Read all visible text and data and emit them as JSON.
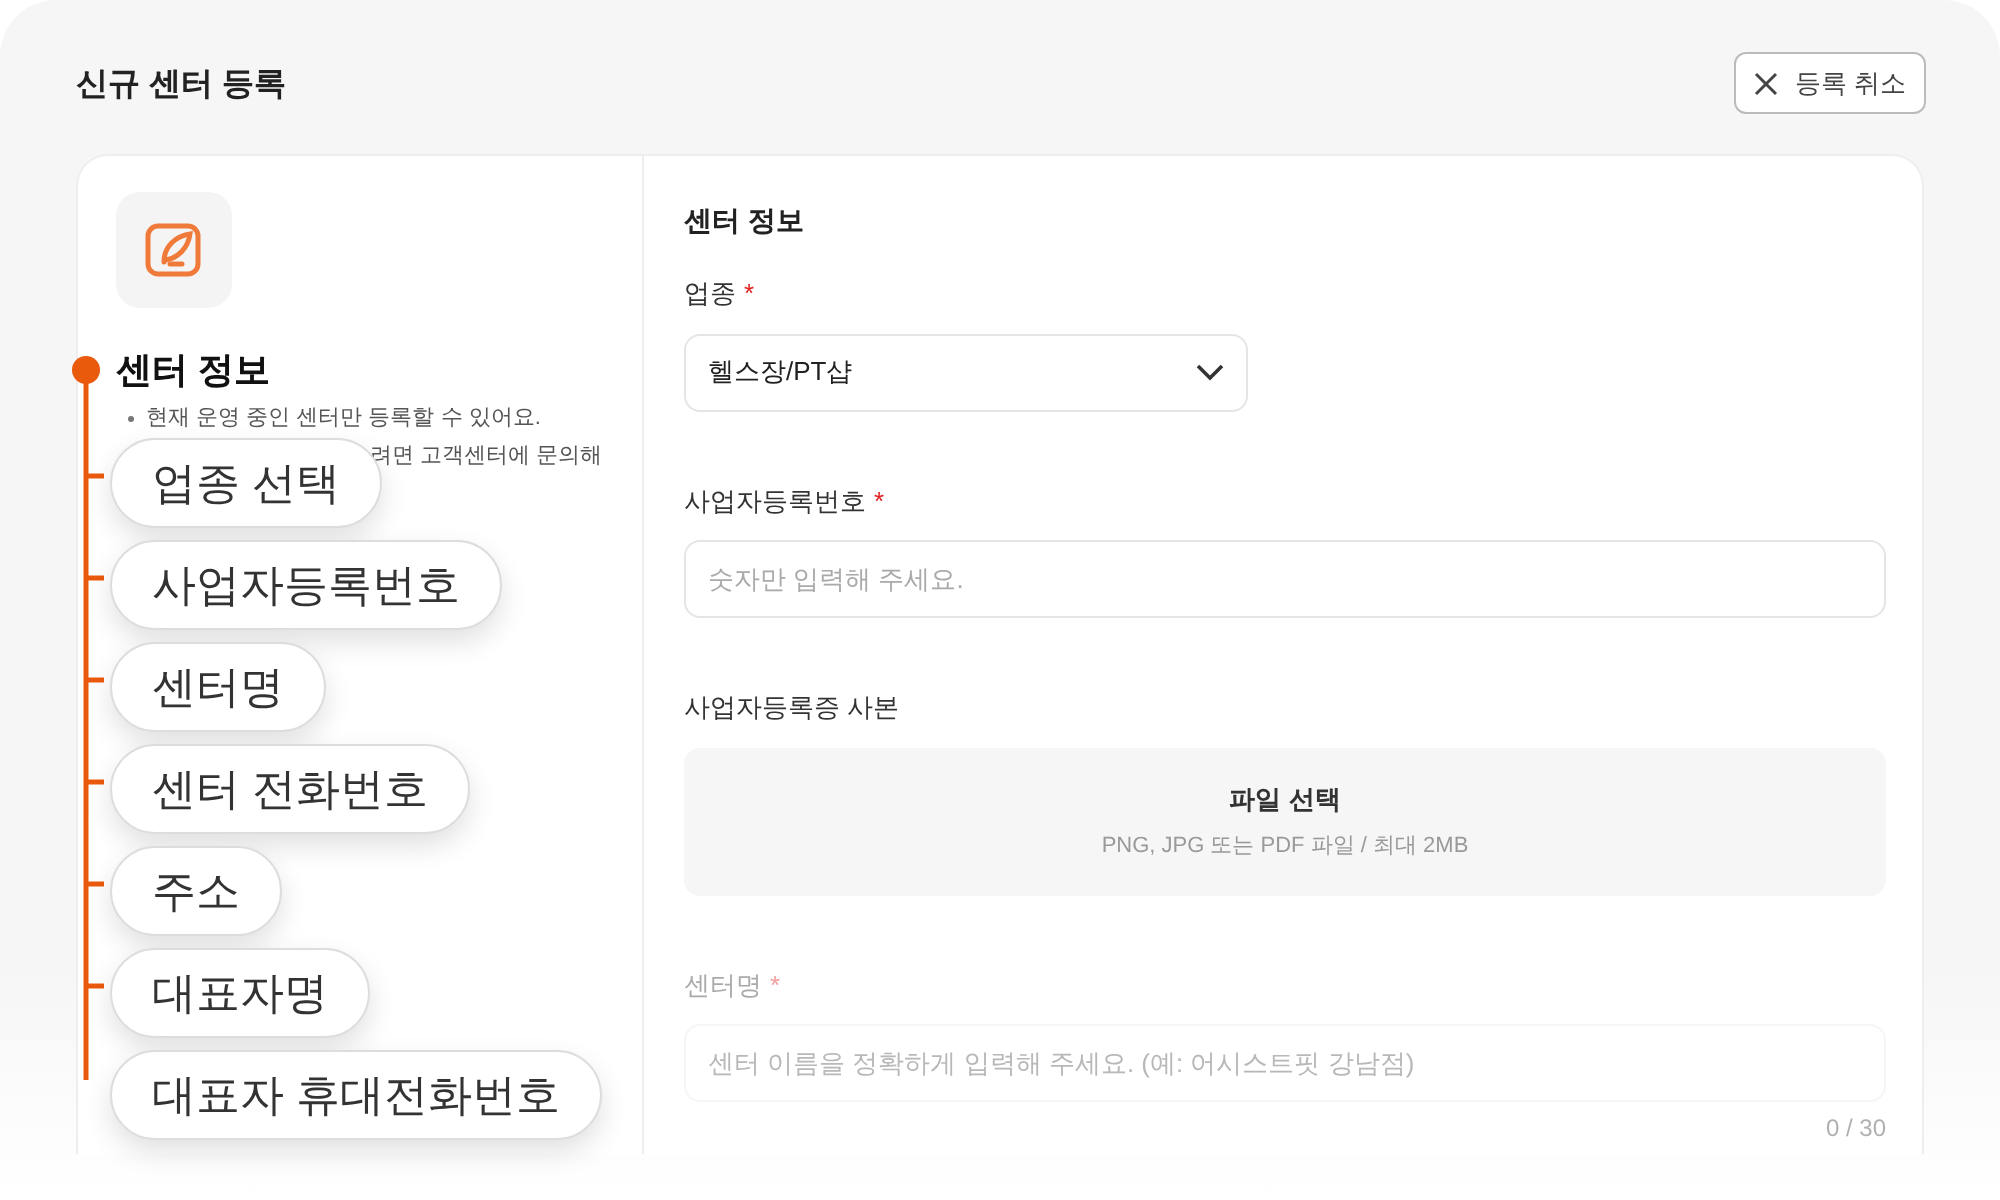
{
  "header": {
    "title": "신규 센터 등록",
    "cancel_button": "등록 취소"
  },
  "sidebar": {
    "heading": "센터 정보",
    "notes": [
      "현재 운영 중인 센터만 등록할 수 있어요.",
      "려면 고객센터에 문의해"
    ]
  },
  "steps": [
    "업종 선택",
    "사업자등록번호",
    "센터명",
    "센터 전화번호",
    "주소",
    "대표자명",
    "대표자 휴대전화번호"
  ],
  "form": {
    "heading": "센터 정보",
    "fields": [
      {
        "kind": "select",
        "label": "업종",
        "required_mark": "*",
        "value": "헬스장/PT샵",
        "faded": false
      },
      {
        "kind": "text",
        "label": "사업자등록번호",
        "required_mark": "*",
        "placeholder": "숫자만 입력해 주세요.",
        "faded": false
      },
      {
        "kind": "file",
        "label": "사업자등록증 사본",
        "button": "파일 선택",
        "hint": "PNG, JPG 또는 PDF 파일 / 최대 2MB",
        "faded": false
      },
      {
        "kind": "text",
        "label": "센터명",
        "required_mark": "*",
        "placeholder": "센터 이름을 정확하게 입력해 주세요. (예: 어시스트핏 강남점)",
        "counter": "0 / 30",
        "faded": true
      }
    ]
  }
}
